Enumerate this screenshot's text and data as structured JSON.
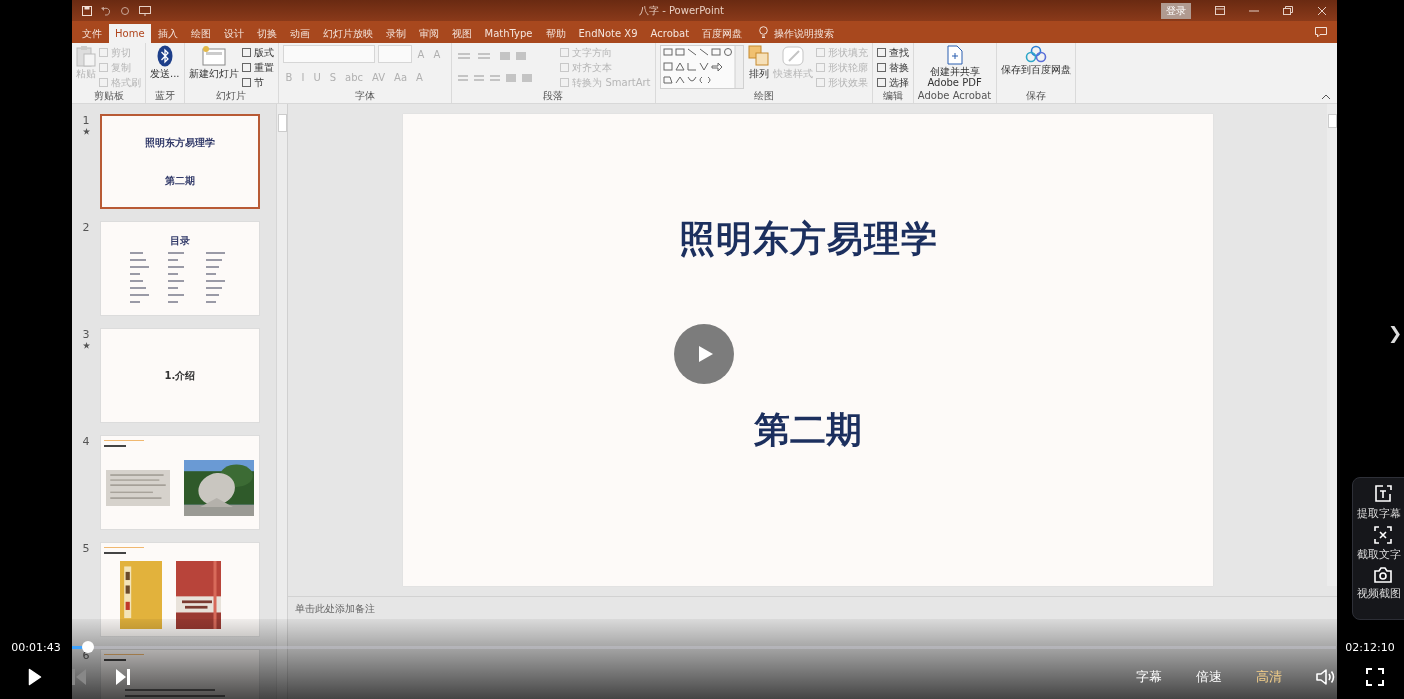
{
  "video": {
    "window": {
      "title": "八字  -  PowerPoint",
      "sign_in": "登录"
    },
    "tabs": [
      {
        "label": "文件",
        "selected": false
      },
      {
        "label": "Home",
        "selected": true
      },
      {
        "label": "插入",
        "selected": false
      },
      {
        "label": "绘图",
        "selected": false
      },
      {
        "label": "设计",
        "selected": false
      },
      {
        "label": "切换",
        "selected": false
      },
      {
        "label": "动画",
        "selected": false
      },
      {
        "label": "幻灯片放映",
        "selected": false
      },
      {
        "label": "录制",
        "selected": false
      },
      {
        "label": "审阅",
        "selected": false
      },
      {
        "label": "视图",
        "selected": false
      },
      {
        "label": "MathType",
        "selected": false
      },
      {
        "label": "帮助",
        "selected": false
      },
      {
        "label": "EndNote X9",
        "selected": false
      },
      {
        "label": "Acrobat",
        "selected": false
      },
      {
        "label": "百度网盘",
        "selected": false
      }
    ],
    "tell_me": "操作说明搜索",
    "ribbon": [
      {
        "label": "剪贴板",
        "kind": "standard",
        "items": [
          {
            "label": "粘贴",
            "kind": "large",
            "disabled": true
          },
          {
            "label": "剪切",
            "kind": "small",
            "disabled": true
          },
          {
            "label": "复制",
            "kind": "small",
            "disabled": true
          },
          {
            "label": "格式刷",
            "kind": "small",
            "disabled": true
          }
        ]
      },
      {
        "label": "蓝牙",
        "kind": "standard",
        "items": [
          {
            "label": "发送...",
            "kind": "large",
            "disabled": false
          }
        ]
      },
      {
        "label": "幻灯片",
        "kind": "standard",
        "items": [
          {
            "label": "新建幻灯片",
            "kind": "large",
            "disabled": false
          },
          {
            "label": "版式",
            "kind": "small",
            "disabled": false
          },
          {
            "label": "重置",
            "kind": "small",
            "disabled": false
          },
          {
            "label": "节",
            "kind": "small",
            "disabled": false
          }
        ]
      },
      {
        "label": "字体",
        "kind": "font",
        "items": [
          {
            "label": "A",
            "disabled": true
          },
          {
            "label": "A",
            "disabled": true
          },
          {
            "label": "B",
            "disabled": true
          },
          {
            "label": "I",
            "disabled": true
          },
          {
            "label": "U",
            "disabled": true
          },
          {
            "label": "S",
            "disabled": true
          },
          {
            "label": "abc",
            "disabled": true
          },
          {
            "label": "AV",
            "disabled": true
          },
          {
            "label": "Aa",
            "disabled": true
          },
          {
            "label": "A",
            "disabled": true
          }
        ]
      },
      {
        "label": "段落",
        "kind": "paragraph",
        "items": [
          {
            "label": "文字方向",
            "kind": "small",
            "disabled": true
          },
          {
            "label": "对齐文本",
            "kind": "small",
            "disabled": true
          },
          {
            "label": "转换为 SmartArt",
            "kind": "small",
            "disabled": true
          }
        ]
      },
      {
        "label": "绘图",
        "kind": "drawing",
        "items": [
          {
            "label": "排列",
            "kind": "large",
            "disabled": false
          },
          {
            "label": "快速样式",
            "kind": "large",
            "disabled": true
          },
          {
            "label": "形状填充",
            "kind": "small",
            "disabled": true
          },
          {
            "label": "形状轮廓",
            "kind": "small",
            "disabled": true
          },
          {
            "label": "形状效果",
            "kind": "small",
            "disabled": true
          }
        ]
      },
      {
        "label": "编辑",
        "kind": "standard",
        "items": [
          {
            "label": "查找",
            "kind": "small",
            "disabled": false
          },
          {
            "label": "替换",
            "kind": "small",
            "disabled": false
          },
          {
            "label": "选择",
            "kind": "small",
            "disabled": false
          }
        ]
      },
      {
        "label": "Adobe Acrobat",
        "kind": "standard",
        "items": [
          {
            "label": "创建并共享 Adobe PDF",
            "kind": "large",
            "disabled": false
          }
        ]
      },
      {
        "label": "保存",
        "kind": "standard",
        "items": [
          {
            "label": "保存到百度网盘",
            "kind": "large",
            "disabled": false
          }
        ]
      }
    ],
    "slides": [
      {
        "number": "1",
        "starred": true,
        "selected": true,
        "kind": "title",
        "title": "照明东方易理学",
        "subtitle": "第二期"
      },
      {
        "number": "2",
        "starred": false,
        "selected": false,
        "kind": "toc",
        "title": "目录"
      },
      {
        "number": "3",
        "starred": true,
        "selected": false,
        "kind": "section",
        "title": "1.介绍"
      },
      {
        "number": "4",
        "starred": false,
        "selected": false,
        "kind": "images"
      },
      {
        "number": "5",
        "starred": false,
        "selected": false,
        "kind": "images"
      },
      {
        "number": "6",
        "starred": false,
        "selected": false,
        "kind": "text"
      }
    ],
    "current_slide": {
      "title": "照明东方易理学",
      "subtitle": "第二期"
    },
    "notes_placeholder": "单击此处添加备注"
  },
  "player": {
    "elapsed": "00:01:43",
    "total": "02:12:10",
    "progress": {
      "level": 0.013
    },
    "options": [
      {
        "label": "字幕",
        "selected": false
      },
      {
        "label": "倍速",
        "selected": false
      },
      {
        "label": "高清",
        "selected": true
      }
    ],
    "next_arrow": "❯",
    "side_tools": [
      {
        "label": "提取字幕",
        "kind": "subtitle"
      },
      {
        "label": "截取文字",
        "kind": "ocr"
      },
      {
        "label": "视频截图",
        "kind": "camera"
      }
    ]
  }
}
